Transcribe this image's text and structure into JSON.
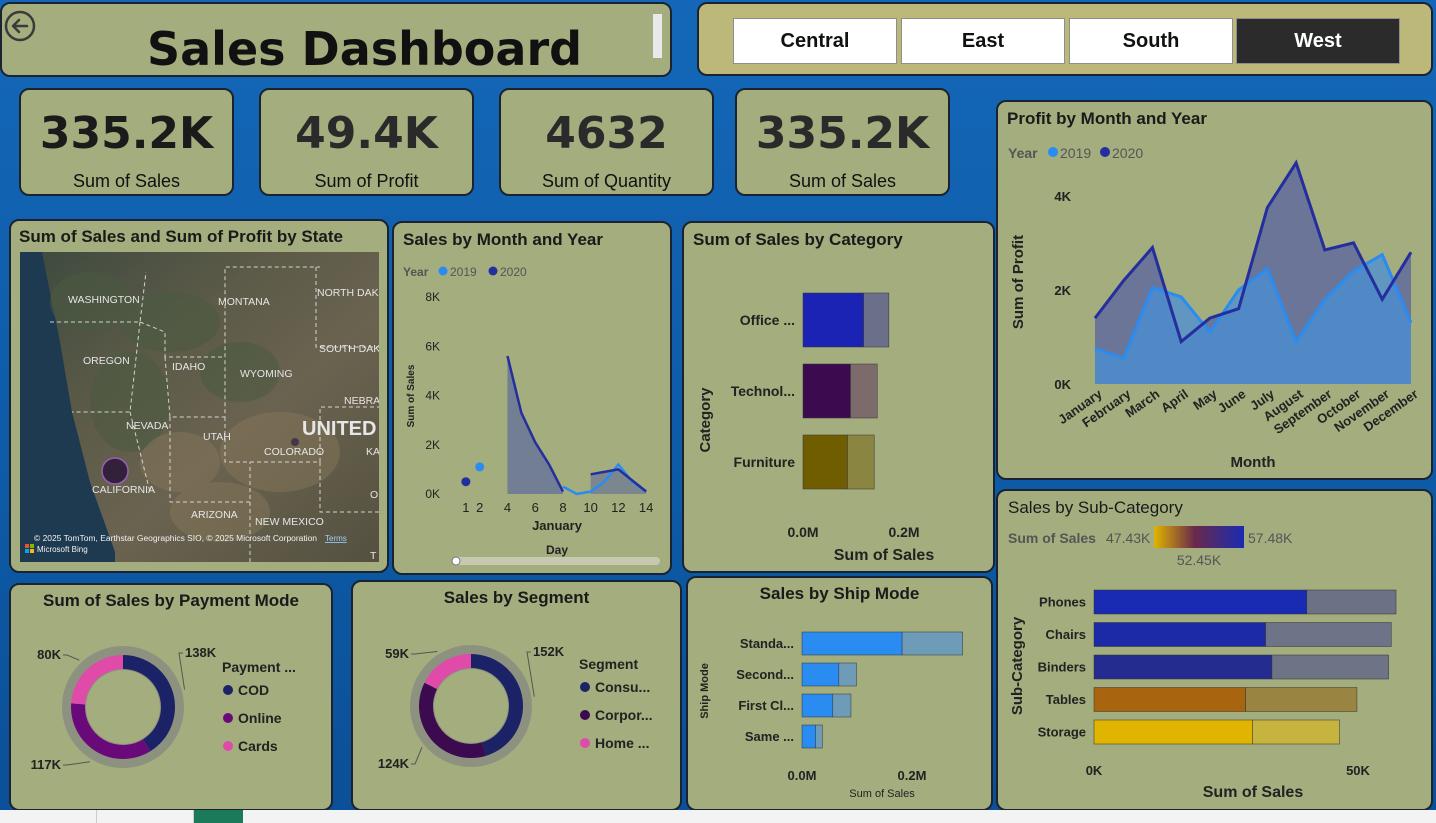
{
  "header": {
    "title": "Sales Dashboard"
  },
  "region_slicer": {
    "options": [
      "Central",
      "East",
      "South",
      "West"
    ],
    "selected": "West"
  },
  "kpis": [
    {
      "value": "335.2K",
      "label": "Sum of Sales"
    },
    {
      "value": "49.4K",
      "label": "Sum of Profit"
    },
    {
      "value": "4632",
      "label": "Sum of Quantity"
    },
    {
      "value": "335.2K",
      "label": "Sum of Sales"
    }
  ],
  "map": {
    "title": "Sum of Sales and Sum of Profit by State",
    "labels": [
      "WASHINGTON",
      "MONTANA",
      "NORTH DAK",
      "OREGON",
      "IDAHO",
      "SOUTH DAK",
      "WYOMING",
      "NEBRA",
      "UNITED",
      "NEVADA",
      "UTAH",
      "COLORADO",
      "KA",
      "CALIFORNIA",
      "ARIZONA",
      "NEW MEXICO",
      "O",
      "T"
    ],
    "attribution": "© 2025 TomTom, Earthstar Geographics SIO, © 2025 Microsoft Corporation",
    "terms": "Terms",
    "brand": "Microsoft Bing"
  },
  "legend_year": {
    "title": "Year",
    "items": [
      "2019",
      "2020"
    ],
    "colors": [
      "#2a8cf0",
      "#242e9e"
    ]
  },
  "chart_data": [
    {
      "id": "sales_by_month_year",
      "type": "line",
      "title": "Sales by Month and Year",
      "xlabel": "Day",
      "xgroup_label": "January",
      "ylabel": "Sum of Sales",
      "x_ticks": [
        1,
        2,
        4,
        6,
        8,
        10,
        12,
        14
      ],
      "y_ticks": [
        "0K",
        "2K",
        "4K",
        "6K",
        "8K"
      ],
      "ylim": [
        0,
        8000
      ],
      "series": [
        {
          "name": "2019",
          "x": [
            2,
            8,
            9,
            10,
            11,
            12,
            13,
            14
          ],
          "y": [
            1100,
            300,
            0,
            100,
            500,
            1200,
            500,
            100
          ]
        },
        {
          "name": "2020",
          "x": [
            1,
            4,
            5,
            6,
            7,
            8,
            10,
            12,
            14
          ],
          "y": [
            500,
            5600,
            3300,
            2100,
            1200,
            100,
            800,
            1000,
            100
          ]
        }
      ]
    },
    {
      "id": "sales_by_category",
      "type": "bar",
      "title": "Sum of Sales by Category",
      "xlabel": "Sum of Sales",
      "ylabel": "Category",
      "x_ticks": [
        "0.0M",
        "0.2M"
      ],
      "categories": [
        "Office ...",
        "Technol...",
        "Furniture"
      ],
      "series": [
        {
          "values": [
            0.12,
            0.094,
            0.088
          ]
        },
        {
          "values": [
            0.05,
            0.053,
            0.053
          ]
        }
      ],
      "colors": [
        [
          "#1a23b3",
          "#6b6f8a"
        ],
        [
          "#3b0a4f",
          "#7d6a6a"
        ],
        [
          "#6f5d00",
          "#8a8540"
        ]
      ]
    },
    {
      "id": "profit_by_month_year",
      "type": "area",
      "title": "Profit by Month and Year",
      "xlabel": "Month",
      "ylabel": "Sum of Profit",
      "y_ticks": [
        "0K",
        "2K",
        "4K"
      ],
      "ylim": [
        0,
        4400
      ],
      "categories": [
        "January",
        "February",
        "March",
        "April",
        "May",
        "June",
        "July",
        "August",
        "September",
        "October",
        "November",
        "December"
      ],
      "series": [
        {
          "name": "2019",
          "values": [
            750,
            550,
            2050,
            1850,
            1100,
            2000,
            2450,
            900,
            1800,
            2400,
            2750,
            1300
          ]
        },
        {
          "name": "2020",
          "values": [
            1400,
            2200,
            2900,
            900,
            1400,
            1600,
            3750,
            4700,
            2850,
            3000,
            1800,
            2800
          ]
        }
      ]
    },
    {
      "id": "sales_by_subcategory",
      "type": "bar",
      "title": "Sales by Sub-Category",
      "xlabel": "Sum of Sales",
      "ylabel": "Sub-Category",
      "x_ticks": [
        "0K",
        "50K"
      ],
      "categories": [
        "Phones",
        "Chairs",
        "Binders",
        "Tables",
        "Storage"
      ],
      "series": [
        {
          "values": [
            40300,
            32500,
            33700,
            28700,
            30000
          ]
        },
        {
          "values": [
            16900,
            23800,
            22100,
            21100,
            16500
          ]
        }
      ],
      "gradient_legend": {
        "label": "Sum of Sales",
        "min": "47.43K",
        "mid": "52.45K",
        "max": "57.48K"
      },
      "colors": [
        [
          "#1a2bb3",
          "#6b7285"
        ],
        [
          "#1c2aa8",
          "#6e7488"
        ],
        [
          "#242c8f",
          "#6f7386"
        ],
        [
          "#a9640f",
          "#9a8442"
        ],
        [
          "#e0b400",
          "#c7b43f"
        ]
      ]
    },
    {
      "id": "sales_by_payment_mode",
      "type": "pie",
      "title": "Sum of Sales by Payment Mode",
      "legend_title": "Payment ...",
      "labels": [
        "COD",
        "Online",
        "Cards"
      ],
      "values": [
        138,
        117,
        80
      ],
      "value_labels": [
        "138K",
        "117K",
        "80K"
      ],
      "colors": [
        "#1c2266",
        "#6a0a7a",
        "#e04aa8"
      ]
    },
    {
      "id": "sales_by_segment",
      "type": "pie",
      "title": "Sales by Segment",
      "legend_title": "Segment",
      "labels": [
        "Consu...",
        "Corpor...",
        "Home ..."
      ],
      "values": [
        152,
        124,
        59
      ],
      "value_labels": [
        "152K",
        "124K",
        "59K"
      ],
      "colors": [
        "#1c2266",
        "#3b0a4f",
        "#e04aa8"
      ]
    },
    {
      "id": "sales_by_ship_mode",
      "type": "bar",
      "title": "Sales by Ship Mode",
      "xlabel": "Sum of Sales",
      "ylabel": "Ship Mode",
      "x_ticks": [
        "0.0M",
        "0.2M"
      ],
      "categories": [
        "Standa...",
        "Second...",
        "First Cl...",
        "Same ..."
      ],
      "series": [
        {
          "values": [
            0.182,
            0.067,
            0.056,
            0.025
          ]
        },
        {
          "values": [
            0.11,
            0.032,
            0.033,
            0.012
          ]
        }
      ],
      "colors": [
        [
          "#2a8cf0",
          "#6e9cb8"
        ],
        [
          "#2a8cf0",
          "#6e9cb8"
        ],
        [
          "#2a8cf0",
          "#6e9cb8"
        ],
        [
          "#2a8cf0",
          "#6e9cb8"
        ]
      ]
    }
  ]
}
